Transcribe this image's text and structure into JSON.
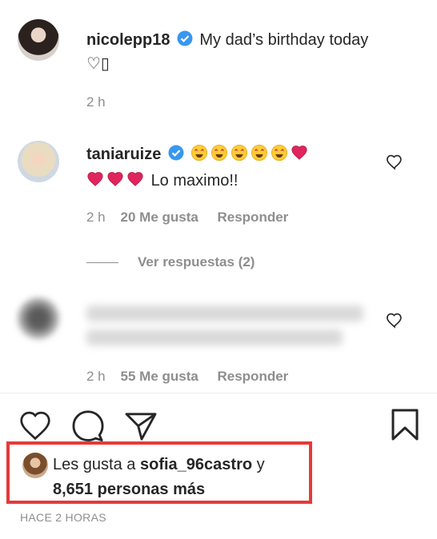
{
  "caption": {
    "username": "nicolepp18",
    "text": "My dad’s birthday today",
    "second_line": "♡▯",
    "time": "2 h"
  },
  "comments": [
    {
      "username": "taniaruize",
      "emoji_row1": [
        "😍",
        "😍",
        "😍",
        "😍",
        "😍",
        "❤"
      ],
      "emoji_row2": [
        "❤",
        "❤",
        "❤"
      ],
      "text": "Lo maximo!!",
      "time": "2 h",
      "likes": "20 Me gusta",
      "reply": "Responder",
      "view_replies": "Ver respuestas (2)"
    },
    {
      "username": "",
      "text": "",
      "time": "2 h",
      "likes": "55 Me gusta",
      "reply": "Responder"
    }
  ],
  "likes_summary": {
    "prefix": "Les gusta a",
    "user": "sofia_96castro",
    "joiner": "y",
    "others": "8,651 personas más"
  },
  "timestamp": "HACE 2 HORAS",
  "colors": {
    "verified": "#3897f0",
    "highlight": "#e6393a",
    "muted": "#8e8e8e"
  },
  "icons": [
    "heart-icon",
    "comment-icon",
    "share-icon",
    "bookmark-icon",
    "verified-icon"
  ]
}
